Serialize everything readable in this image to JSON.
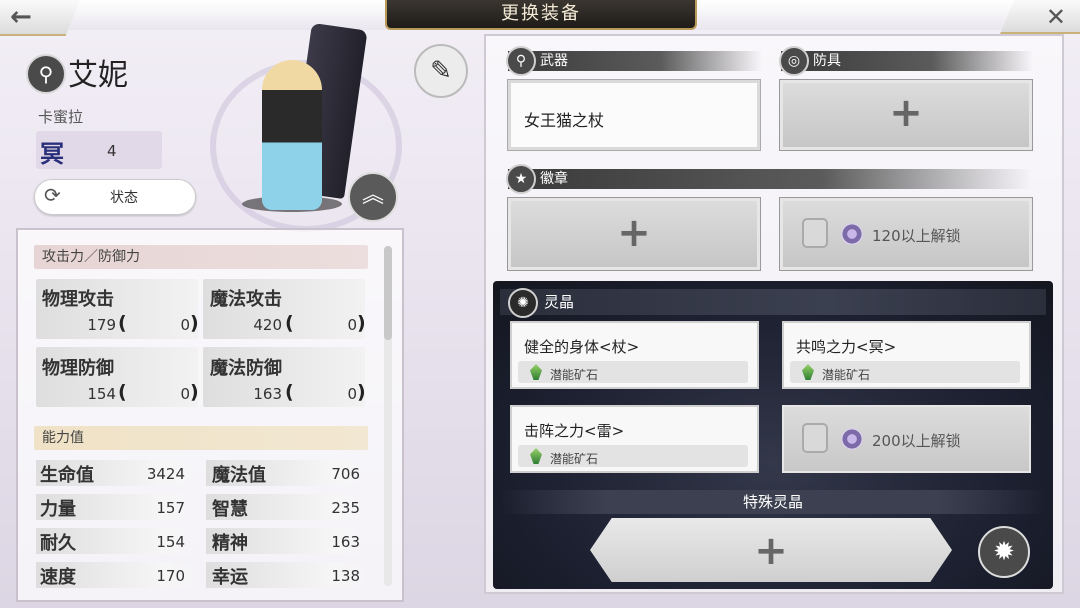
{
  "header": {
    "back_icon": "←",
    "title": "更换装备",
    "close_icon": "✕"
  },
  "character": {
    "icon": "staff-icon",
    "name": "艾妮",
    "subtitle": "卡蜜拉",
    "rank_glyph": "冥",
    "rank_value": "4",
    "status_label": "状态"
  },
  "stats": {
    "attack_section": "攻击力／防御力",
    "combat": [
      {
        "name": "物理攻击",
        "value": "179",
        "bonus": "0"
      },
      {
        "name": "魔法攻击",
        "value": "420",
        "bonus": "0"
      },
      {
        "name": "物理防御",
        "value": "154",
        "bonus": "0"
      },
      {
        "name": "魔法防御",
        "value": "163",
        "bonus": "0"
      }
    ],
    "ability_section": "能力值",
    "abilities": [
      {
        "name": "生命值",
        "value": "3424"
      },
      {
        "name": "魔法值",
        "value": "706"
      },
      {
        "name": "力量",
        "value": "157"
      },
      {
        "name": "智慧",
        "value": "235"
      },
      {
        "name": "耐久",
        "value": "154"
      },
      {
        "name": "精神",
        "value": "163"
      },
      {
        "name": "速度",
        "value": "170"
      },
      {
        "name": "幸运",
        "value": "138"
      }
    ],
    "paren_open": "(",
    "paren_close": ")"
  },
  "equipment": {
    "weapon_label": "武器",
    "weapon_item": "女王猫之杖",
    "armor_label": "防具",
    "badge_label": "徽章",
    "badge_lock_text": "120以上解锁",
    "plus": "+"
  },
  "crystals": {
    "label": "灵晶",
    "slots": [
      {
        "name": "健全的身体<杖>",
        "ore": "潜能矿石"
      },
      {
        "name": "共鸣之力<冥>",
        "ore": "潜能矿石"
      },
      {
        "name": "击阵之力<雷>",
        "ore": "潜能矿石"
      }
    ],
    "lock_text": "200以上解锁",
    "special_label": "特殊灵晶"
  }
}
